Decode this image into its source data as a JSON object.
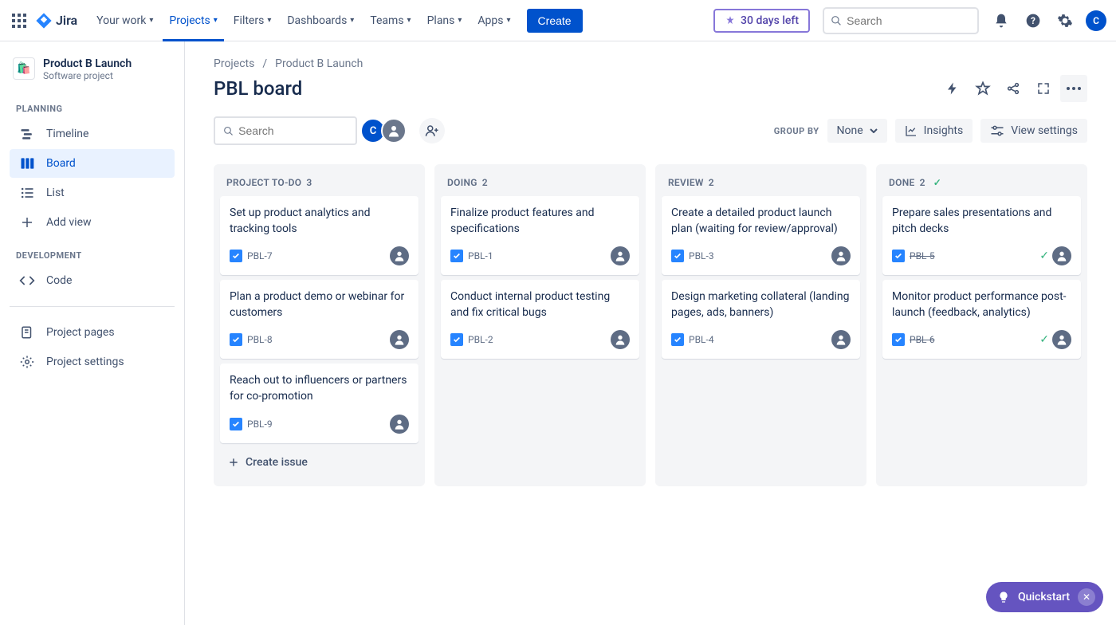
{
  "topnav": {
    "product": "Jira",
    "items": [
      {
        "label": "Your work"
      },
      {
        "label": "Projects",
        "active": true
      },
      {
        "label": "Filters"
      },
      {
        "label": "Dashboards"
      },
      {
        "label": "Teams"
      },
      {
        "label": "Plans"
      },
      {
        "label": "Apps"
      }
    ],
    "create_label": "Create",
    "trial_label": "30 days left",
    "search_placeholder": "Search",
    "avatar_initial": "C"
  },
  "sidebar": {
    "project_name": "Product B Launch",
    "project_type": "Software project",
    "sections": {
      "planning_label": "PLANNING",
      "development_label": "DEVELOPMENT"
    },
    "items": {
      "timeline": "Timeline",
      "board": "Board",
      "list": "List",
      "add_view": "Add view",
      "code": "Code",
      "project_pages": "Project pages",
      "project_settings": "Project settings"
    }
  },
  "breadcrumb": {
    "root": "Projects",
    "current": "Product B Launch"
  },
  "page": {
    "title": "PBL board",
    "search_placeholder": "Search",
    "groupby_label": "GROUP BY",
    "groupby_value": "None",
    "insights_label": "Insights",
    "view_settings_label": "View settings",
    "create_issue_label": "Create issue"
  },
  "board": {
    "columns": [
      {
        "name": "PROJECT TO-DO",
        "count": 3,
        "done": false,
        "cards": [
          {
            "title": "Set up product analytics and tracking tools",
            "key": "PBL-7",
            "done": false
          },
          {
            "title": "Plan a product demo or webinar for customers",
            "key": "PBL-8",
            "done": false
          },
          {
            "title": "Reach out to influencers or partners for co-promotion",
            "key": "PBL-9",
            "done": false
          }
        ],
        "show_create": true
      },
      {
        "name": "DOING",
        "count": 2,
        "done": false,
        "cards": [
          {
            "title": "Finalize product features and specifications",
            "key": "PBL-1",
            "done": false
          },
          {
            "title": "Conduct internal product testing and fix critical bugs",
            "key": "PBL-2",
            "done": false
          }
        ],
        "show_create": false
      },
      {
        "name": "REVIEW",
        "count": 2,
        "done": false,
        "cards": [
          {
            "title": "Create a detailed product launch plan (waiting for review/approval)",
            "key": "PBL-3",
            "done": false
          },
          {
            "title": "Design marketing collateral (landing pages, ads, banners)",
            "key": "PBL-4",
            "done": false
          }
        ],
        "show_create": false
      },
      {
        "name": "DONE",
        "count": 2,
        "done": true,
        "cards": [
          {
            "title": "Prepare sales presentations and pitch decks",
            "key": "PBL-5",
            "done": true
          },
          {
            "title": "Monitor product performance post-launch (feedback, analytics)",
            "key": "PBL-6",
            "done": true
          }
        ],
        "show_create": false
      }
    ]
  },
  "quickstart": {
    "label": "Quickstart"
  }
}
